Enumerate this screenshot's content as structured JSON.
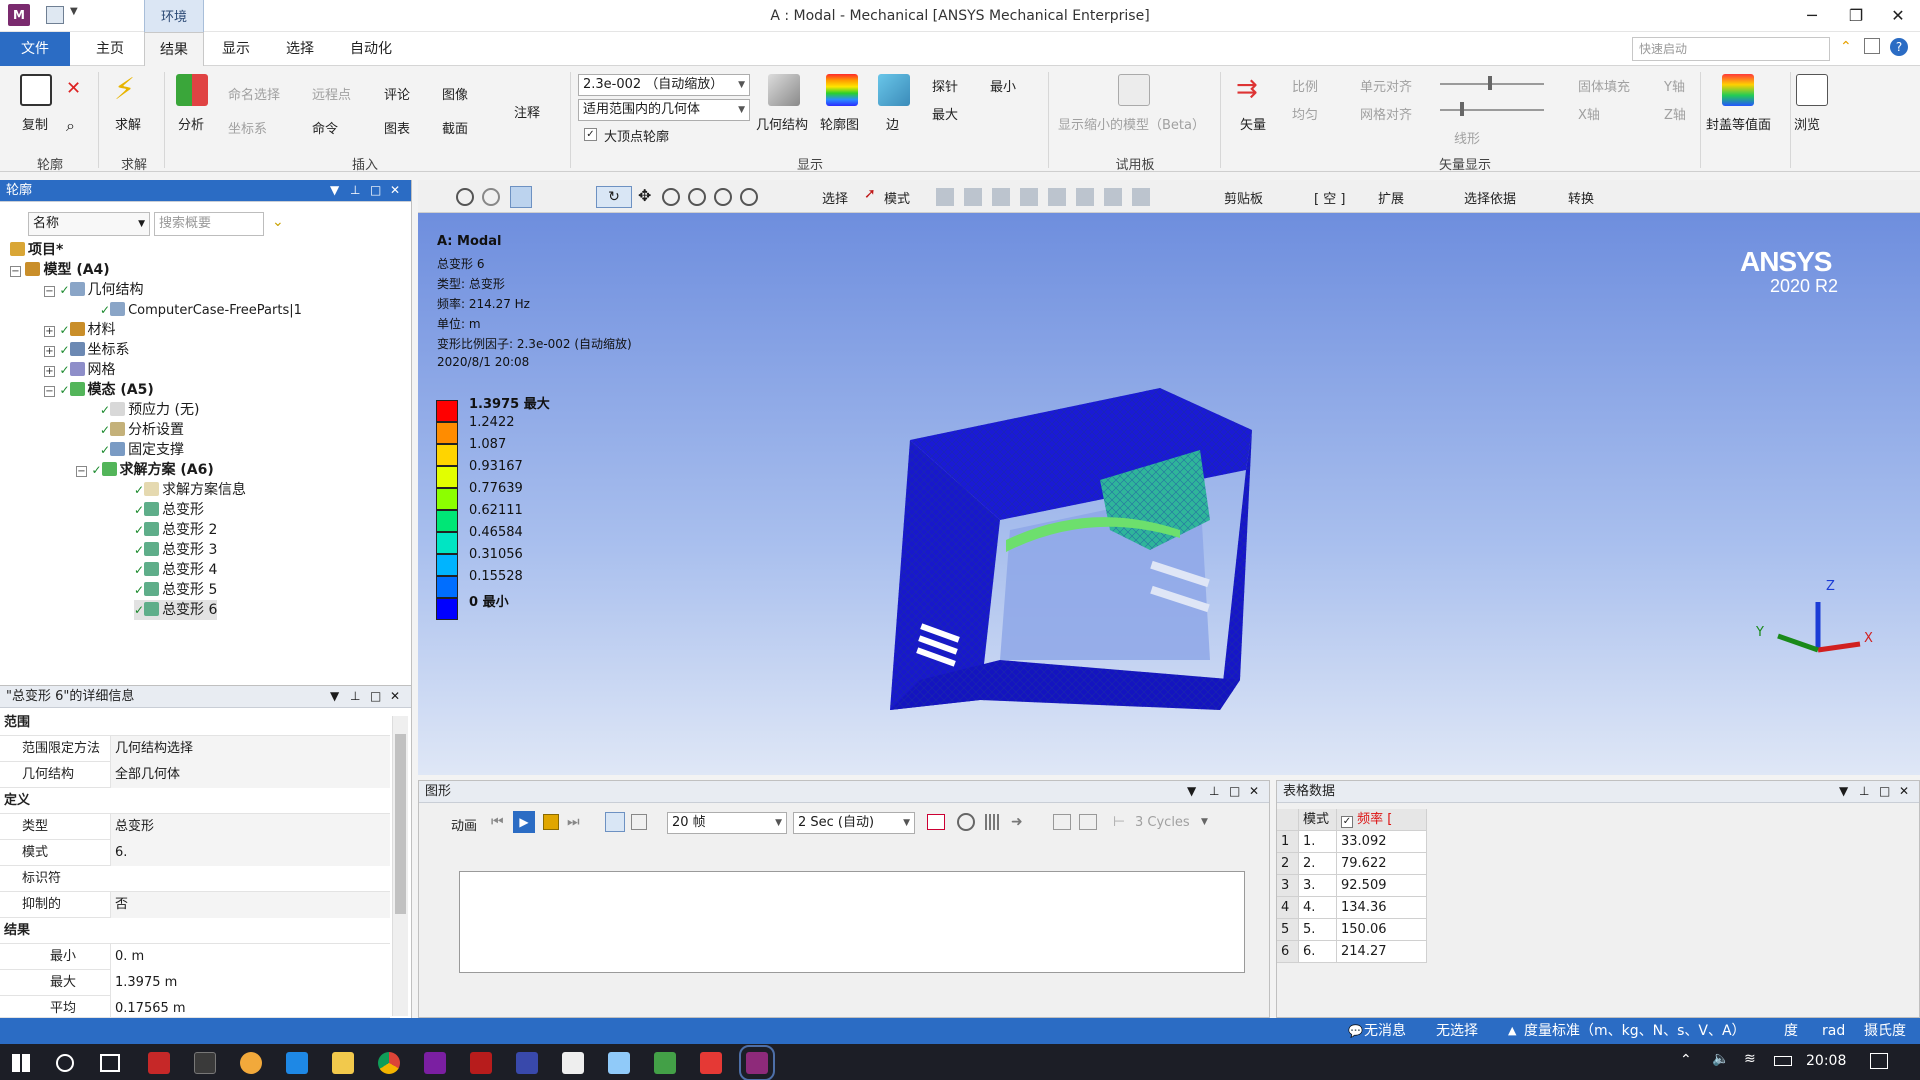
{
  "title_bar": {
    "app_logo": "M",
    "context_tab": "环境",
    "window_title": "A : Modal - Mechanical [ANSYS Mechanical Enterprise]"
  },
  "tabs": {
    "file": "文件",
    "home": "主页",
    "result": "结果",
    "display": "显示",
    "selection": "选择",
    "automation": "自动化",
    "quick_launch_placeholder": "快速启动"
  },
  "ribbon": {
    "outline_group": {
      "copy": "复制",
      "label": "轮廓"
    },
    "solve_group": {
      "solve": "求解",
      "label": "求解"
    },
    "insert_group": {
      "analysis": "分析",
      "named_selection": "命名选择",
      "remote_point": "远程点",
      "comment": "评论",
      "image": "图像",
      "coordinate_system": "坐标系",
      "command": "命令",
      "chart": "图表",
      "section": "截面",
      "annotation": "注释",
      "label": "插入"
    },
    "display_group": {
      "scale_value": "2.3e-002 （自动缩放）",
      "geometry_scope": "适用范围内的几何体",
      "max_vertex_contour": "大顶点轮廓",
      "geometry": "几何结构",
      "contour": "轮廓图",
      "edges": "边",
      "probe": "探针",
      "min": "最小",
      "max": "最大",
      "label": "显示"
    },
    "trial_group": {
      "show_reduced_model": "显示缩小的模型（Beta）",
      "label": "试用板"
    },
    "vector_group": {
      "vector": "矢量",
      "proportional": "比例",
      "uniform": "均匀",
      "element_aligned": "单元对齐",
      "grid_aligned": "网格对齐",
      "line": "线形",
      "solid_fill": "固体填充",
      "y_axis": "Y轴",
      "x_axis": "X轴",
      "z_axis": "Z轴",
      "label": "矢量显示"
    },
    "capped_isosurface": "封盖等值面",
    "browse": "浏览"
  },
  "outline": {
    "header": "轮廓",
    "filter_name": "名称",
    "search_placeholder": "搜索概要",
    "tree": {
      "project": "项目*",
      "model": "模型 (A4)",
      "geometry": "几何结构",
      "part": "ComputerCase-FreeParts|1",
      "materials": "材料",
      "coords": "坐标系",
      "mesh": "网格",
      "modal": "模态 (A5)",
      "prestress": "预应力 (无)",
      "analysis_settings": "分析设置",
      "fixed_support": "固定支撑",
      "solution": "求解方案 (A6)",
      "solution_info": "求解方案信息",
      "td1": "总变形",
      "td2": "总变形 2",
      "td3": "总变形 3",
      "td4": "总变形 4",
      "td5": "总变形 5",
      "td6": "总变形 6"
    }
  },
  "details": {
    "header": "\"总变形 6\"的详细信息",
    "sections": {
      "scope": "范围",
      "definition": "定义",
      "results": "结果"
    },
    "rows": {
      "scoping_method_k": "范围限定方法",
      "scoping_method_v": "几何结构选择",
      "geometry_k": "几何结构",
      "geometry_v": "全部几何体",
      "type_k": "类型",
      "type_v": "总变形",
      "mode_k": "模式",
      "mode_v": "6.",
      "identifier_k": "标识符",
      "identifier_v": "",
      "suppressed_k": "抑制的",
      "suppressed_v": "否",
      "min_k": "最小",
      "min_v": "0. m",
      "max_k": "最大",
      "max_v": "1.3975 m",
      "avg_k": "平均",
      "avg_v": "0.17565 m"
    }
  },
  "viewport": {
    "toolbar": {
      "select": "选择",
      "mode": "模式",
      "clipboard": "剪贴板",
      "empty": "[ 空 ]",
      "extend": "扩展",
      "select_by": "选择依据",
      "convert": "转换"
    },
    "info": {
      "title": "A: Modal",
      "line1": "总变形 6",
      "line2": "类型: 总变形",
      "line3": "频率: 214.27   Hz",
      "line4": "单位: m",
      "line5": "变形比例因子: 2.3e-002   (自动缩放)",
      "line6": "2020/8/1 20:08"
    },
    "legend": {
      "max_label": "1.3975 最大",
      "v1": "1.2422",
      "v2": "1.087",
      "v3": "0.93167",
      "v4": "0.77639",
      "v5": "0.62111",
      "v6": "0.46584",
      "v7": "0.31056",
      "v8": "0.15528",
      "min_label": "0 最小",
      "colors": [
        "#ff0000",
        "#ff8c00",
        "#ffd400",
        "#e2ff00",
        "#8cff00",
        "#00e676",
        "#00e5c3",
        "#00b4ff",
        "#006eff",
        "#0000ff"
      ]
    },
    "logo": "ANSYS",
    "version": "2020 R2",
    "axes": {
      "x": "X",
      "y": "Y",
      "z": "Z"
    }
  },
  "graph_panel": {
    "header": "图形",
    "animation": "动画",
    "frames": "20 帧",
    "duration": "2 Sec (自动)",
    "cycles": "3 Cycles"
  },
  "tabular": {
    "header": "表格数据",
    "col_mode": "模式",
    "col_freq": "频率 [",
    "rows": [
      {
        "idx": "1",
        "mode": "1.",
        "freq": "33.092"
      },
      {
        "idx": "2",
        "mode": "2.",
        "freq": "79.622"
      },
      {
        "idx": "3",
        "mode": "3.",
        "freq": "92.509"
      },
      {
        "idx": "4",
        "mode": "4.",
        "freq": "134.36"
      },
      {
        "idx": "5",
        "mode": "5.",
        "freq": "150.06"
      },
      {
        "idx": "6",
        "mode": "6.",
        "freq": "214.27"
      }
    ]
  },
  "status_bar": {
    "messages": "无消息",
    "selection": "无选择",
    "units": "度量标准（m、kg、N、s、V、A）",
    "angle": "度",
    "rad": "rad",
    "temp": "摄氏度"
  },
  "taskbar": {
    "clock": "20:08"
  }
}
